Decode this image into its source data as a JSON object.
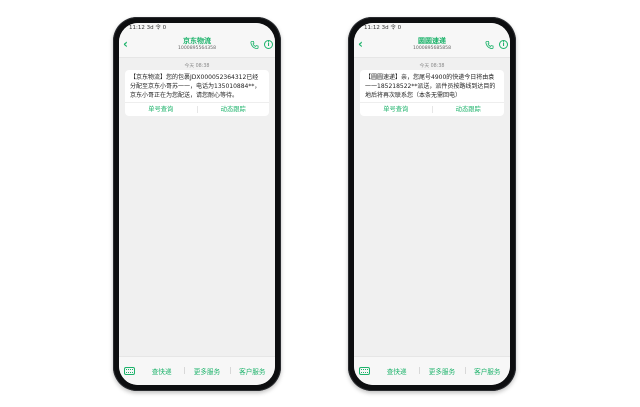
{
  "colors": {
    "accent": "#1db36b",
    "screen_bg": "#f0f0f0",
    "frame": "#0d0e10"
  },
  "phones": [
    {
      "status": "11:12 3d 令 0",
      "contact": "京东物流",
      "number": "1000895564358",
      "timestamp": "今天 08:38",
      "message": "【京东物流】您的包裹JDX000052364312已经分配至京东小哥苏一一，电话为135010884**，京东小哥正在为您配送，请您耐心等待。",
      "actions": [
        "单号查询",
        "动态跟踪"
      ],
      "menu": [
        "查快递",
        "更多服务",
        "客户服务"
      ]
    },
    {
      "status": "11:12 3d 令 0",
      "contact": "圆圆速递",
      "number": "1000895685858",
      "timestamp": "今天 08:38",
      "message": "【圆圆速递】亲，您尾号4900的快递今日将由袁一一185218522**派送，派件员按路线到达目的地后将再次联系您（本条无需回电）",
      "actions": [
        "单号查询",
        "动态跟踪"
      ],
      "menu": [
        "查快递",
        "更多服务",
        "客户服务"
      ]
    }
  ],
  "icons": [
    "back-icon",
    "phone-call-icon",
    "info-icon",
    "keyboard-icon"
  ]
}
